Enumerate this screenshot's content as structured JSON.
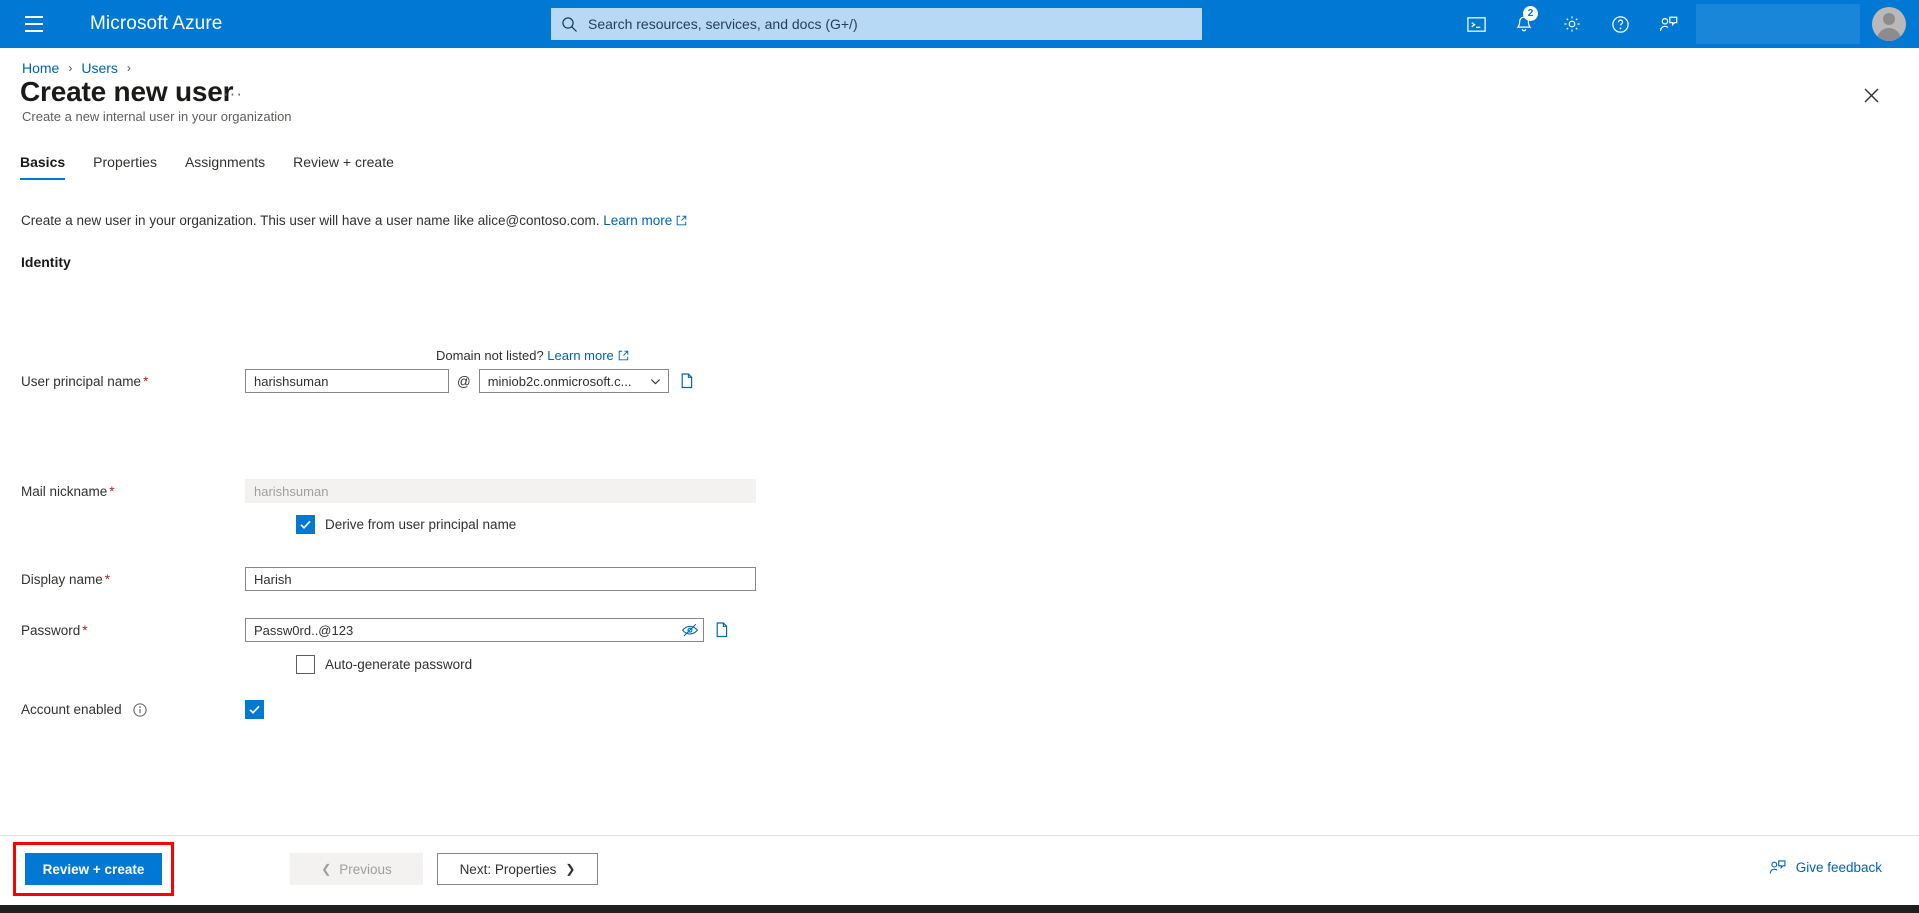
{
  "topbar": {
    "menu_icon": "hamburger-icon",
    "brand": "Microsoft Azure",
    "search": {
      "icon": "search-icon",
      "placeholder": "Search resources, services, and docs (G+/)",
      "value": ""
    },
    "icons": [
      {
        "name": "cloud-shell-icon",
        "label": "Cloud Shell"
      },
      {
        "name": "notifications-icon",
        "label": "Notifications",
        "badge": "2"
      },
      {
        "name": "gear-icon",
        "label": "Settings"
      },
      {
        "name": "help-icon",
        "label": "Help"
      },
      {
        "name": "feedback-icon",
        "label": "Feedback"
      }
    ],
    "avatar": "user-avatar"
  },
  "breadcrumb": {
    "items": [
      "Home",
      "Users"
    ],
    "separator": "›"
  },
  "header": {
    "title": "Create new user",
    "more_label": "···",
    "subtitle": "Create a new internal user in your organization",
    "close_icon": "close-icon"
  },
  "tabs": [
    {
      "label": "Basics",
      "active": true
    },
    {
      "label": "Properties",
      "active": false
    },
    {
      "label": "Assignments",
      "active": false
    },
    {
      "label": "Review + create",
      "active": false
    }
  ],
  "intro": {
    "text": "Create a new user in your organization. This user will have a user name like alice@contoso.com.",
    "link": "Learn more",
    "link_icon": "external-link-icon"
  },
  "identity": {
    "section_title": "Identity",
    "upn": {
      "label": "User principal name",
      "required": "*",
      "value": "harishsuman",
      "placeholder": "",
      "at": "@",
      "domain_selected": "miniob2c.onmicrosoft.c...",
      "dropdown_icon": "chevron-down-icon",
      "copy_icon": "copy-icon"
    },
    "domain_note": {
      "text": "Domain not listed?",
      "link": "Learn more",
      "link_icon": "external-link-icon"
    },
    "mail_nickname": {
      "label": "Mail nickname",
      "required": "*",
      "value": "harishsuman",
      "disabled": true,
      "checkbox_label": "Derive from user principal name",
      "checkbox_checked": true
    },
    "display_name": {
      "label": "Display name",
      "required": "*",
      "value": "Harish",
      "placeholder": ""
    },
    "password": {
      "label": "Password",
      "required": "*",
      "value": "Passw0rd..@123",
      "reveal_icon": "eye-off-icon",
      "copy_icon": "copy-icon",
      "autogen_label": "Auto-generate password",
      "autogen_checked": false
    },
    "account_enabled": {
      "label": "Account enabled",
      "info_icon": "info-icon",
      "checked": true
    }
  },
  "footer": {
    "review_create": "Review + create",
    "previous": "Previous",
    "previous_icon": "chevron-left-icon",
    "next": "Next: Properties",
    "next_icon": "chevron-right-icon",
    "give_feedback": "Give feedback",
    "feedback_icon": "feedback-person-icon"
  },
  "colors": {
    "azure_blue": "#0078d4",
    "link_blue": "#0063b1",
    "required_red": "#a4262c",
    "highlight_red": "#ff0000"
  }
}
